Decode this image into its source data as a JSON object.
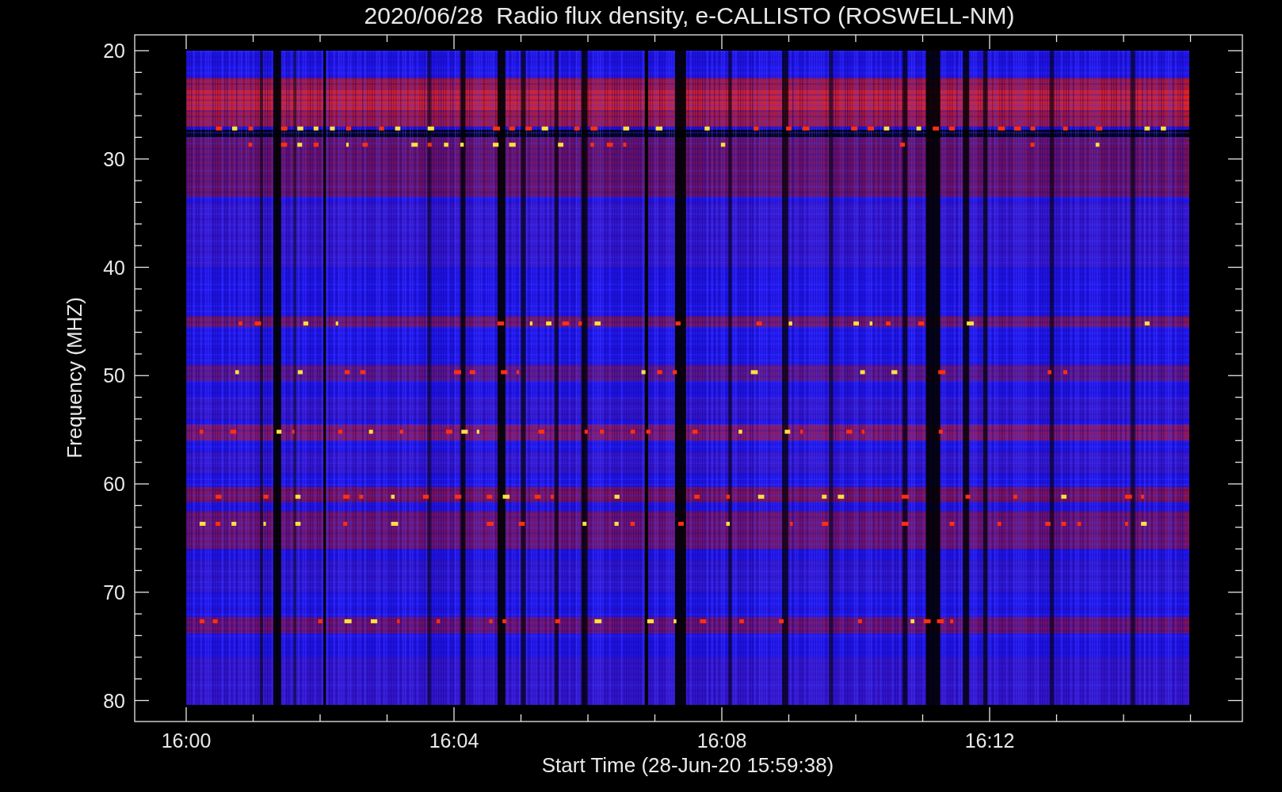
{
  "plot": {
    "title": "2020/06/28  Radio flux density, e-CALLISTO (ROSWELL-NM)",
    "xlabel": "Start Time (28-Jun-20 15:59:38)",
    "ylabel": "Frequency (MHZ)",
    "xtick_labels": [
      "16:00",
      "16:04",
      "16:08",
      "16:12"
    ],
    "ytick_labels": [
      "20",
      "30",
      "40",
      "50",
      "60",
      "70",
      "80"
    ]
  }
}
